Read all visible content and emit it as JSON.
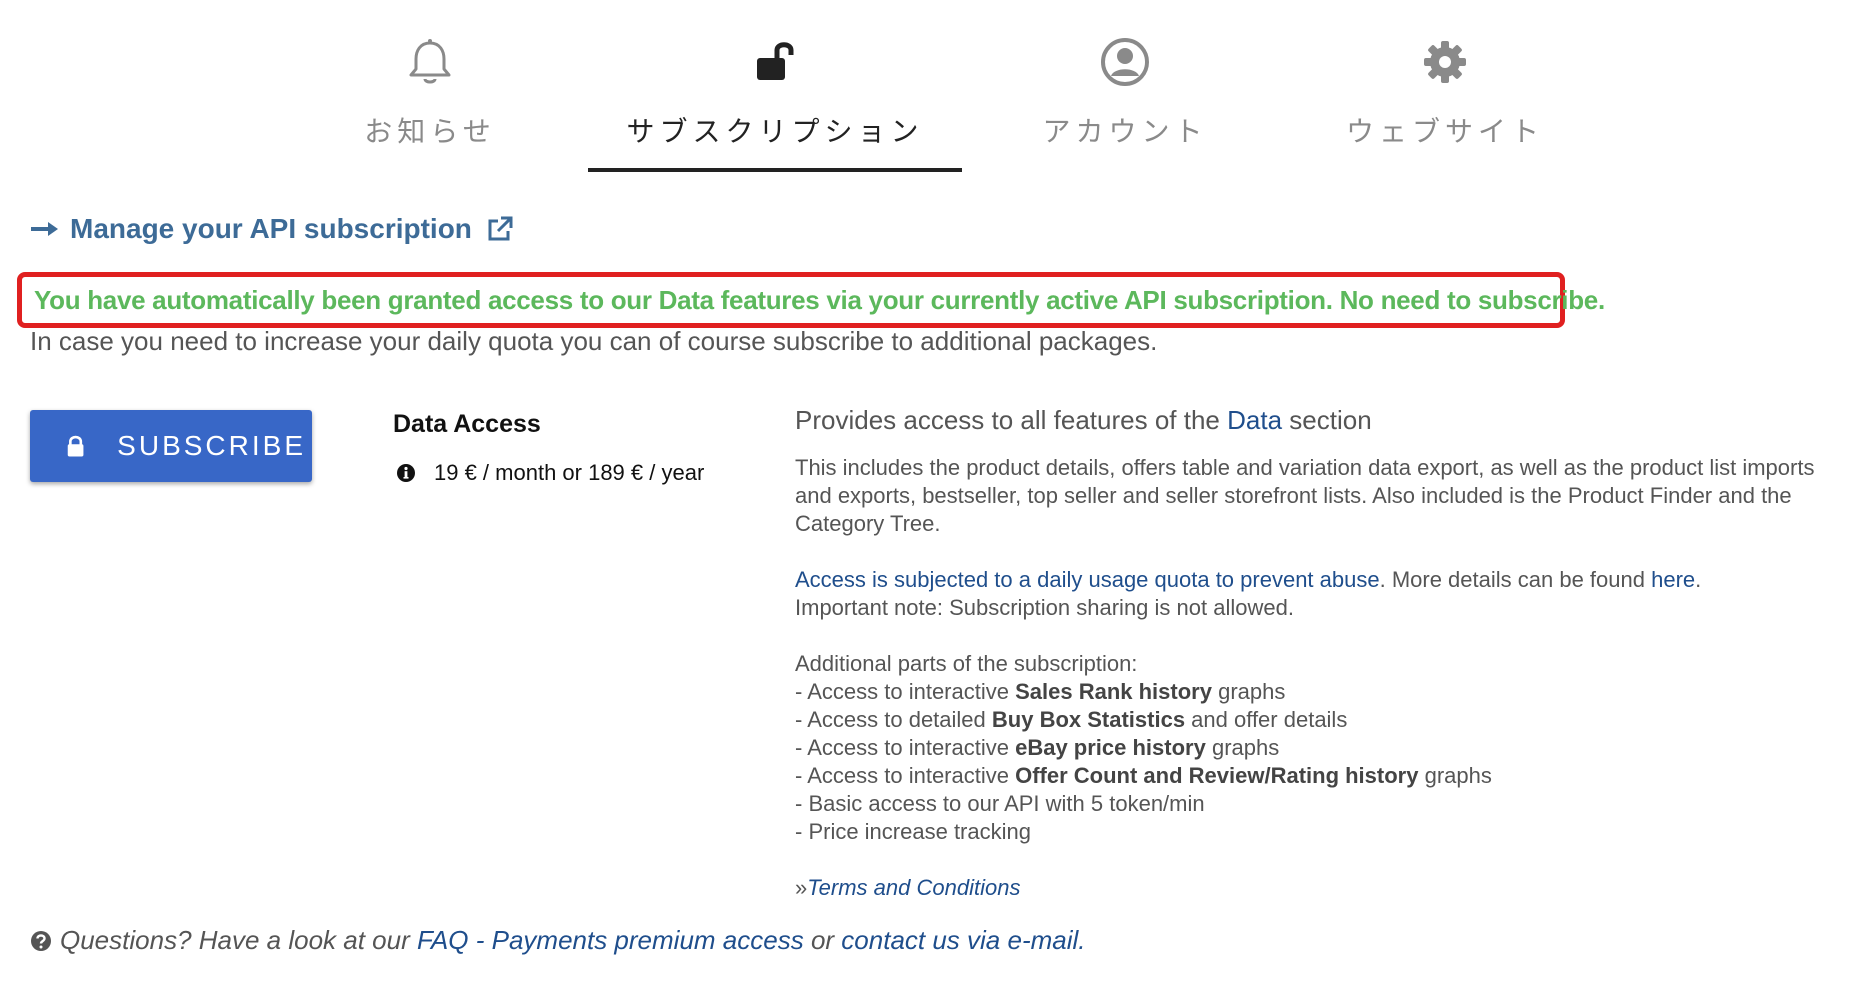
{
  "tabs": [
    {
      "label": "お知らせ",
      "icon": "bell-icon",
      "active": false
    },
    {
      "label": "サブスクリプション",
      "icon": "unlock-icon",
      "active": true
    },
    {
      "label": "アカウント",
      "icon": "user-circle-icon",
      "active": false
    },
    {
      "label": "ウェブサイト",
      "icon": "gear-icon",
      "active": false
    }
  ],
  "manage_link": {
    "label": "Manage your API subscription",
    "icon_left": "arrow-right-icon",
    "icon_right": "external-link-icon"
  },
  "notice": {
    "highlight": "You have automatically been granted access to our Data features via your currently active API subscription. No need to subscribe.",
    "subtext": "In case you need to increase your daily quota you can of course subscribe to additional packages."
  },
  "subscribe_button": {
    "label": "SUBSCRIBE",
    "icon": "lock-icon"
  },
  "plan": {
    "title": "Data Access",
    "price": "19 € / month or 189 € / year",
    "price_icon": "info-icon"
  },
  "description": {
    "heading_prefix": "Provides access to all features of the ",
    "heading_link": "Data",
    "heading_suffix": " section",
    "para1": "This includes the product details, offers table and variation data export, as well as the product list imports and exports, bestseller, top seller and seller storefront lists. Also included is the Product Finder and the Category Tree.",
    "quota_link": "Access is subjected to a daily usage quota to prevent abuse",
    "more_details_prefix": ". More details can be found ",
    "here_link": "here",
    "more_details_suffix": ".",
    "important_note": "Important note: Subscription sharing is not allowed.",
    "additional_heading": "Additional parts of the subscription:",
    "items": [
      {
        "prefix": "- Access to interactive ",
        "bold": "Sales Rank history",
        "suffix": " graphs"
      },
      {
        "prefix": "- Access to detailed ",
        "bold": "Buy Box Statistics",
        "suffix": " and offer details"
      },
      {
        "prefix": "- Access to interactive ",
        "bold": "eBay price history",
        "suffix": " graphs"
      },
      {
        "prefix": "- Access to interactive ",
        "bold": "Offer Count and Review/Rating history",
        "suffix": " graphs"
      },
      {
        "prefix": "- Basic access to our API with 5 token/min",
        "bold": "",
        "suffix": ""
      },
      {
        "prefix": "- Price increase tracking",
        "bold": "",
        "suffix": ""
      }
    ],
    "terms_prefix": "»",
    "terms_link": "Terms and Conditions"
  },
  "footer": {
    "icon": "question-circle-icon",
    "prefix": "Questions? Have a look at our ",
    "faq_link": "FAQ - Payments premium access",
    "middle": " or ",
    "contact_link": "contact us via e-mail."
  },
  "colors": {
    "accent_blue": "#3867c7",
    "link": "#1f4e8c",
    "success_green": "#5cb85c",
    "highlight_border": "#e02020"
  }
}
